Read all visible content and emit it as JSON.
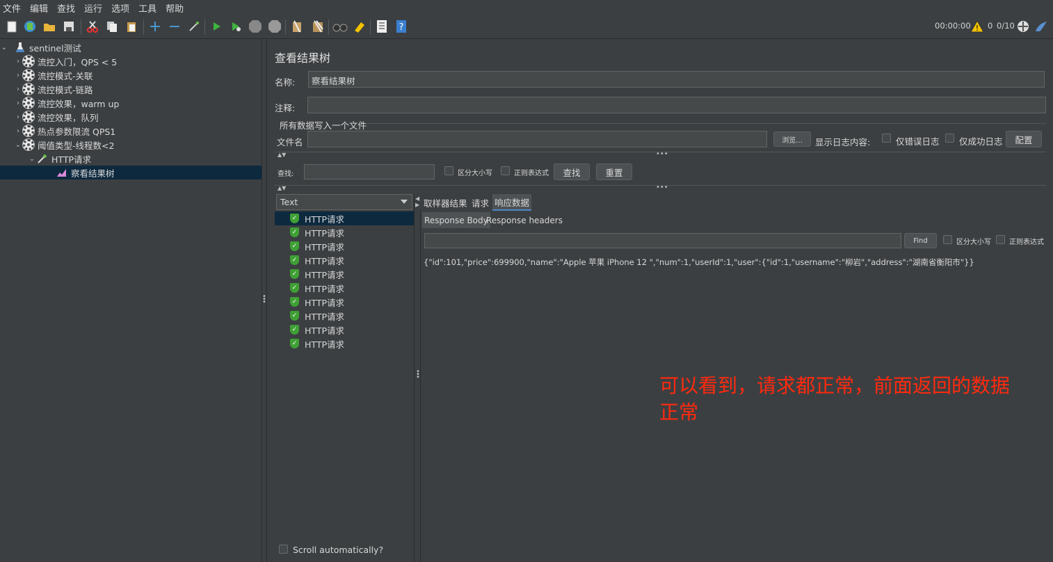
{
  "menu": [
    "文件",
    "编辑",
    "查找",
    "运行",
    "选项",
    "工具",
    "帮助"
  ],
  "status": {
    "timer": "00:00:00",
    "warnings": "0",
    "threads": "0/10"
  },
  "tree": {
    "root": "sentinel测试",
    "items": [
      "流控入门，QPS < 5",
      "流控模式-关联",
      "流控模式-链路",
      "流控效果，warm up",
      "流控效果，队列",
      "热点参数限流 QPS1",
      "阈值类型-线程数<2"
    ],
    "child": "HTTP请求",
    "grandchild": "察看结果树"
  },
  "panel": {
    "title": "查看结果树",
    "name_label": "名称:",
    "name_value": "察看结果树",
    "comment_label": "注释:",
    "comment_value": "",
    "write_all_label": "所有数据写入一个文件",
    "filename_label": "文件名",
    "filename_value": "",
    "browse_label": "浏览...",
    "log_content_label": "显示日志内容:",
    "errors_only_label": "仅错误日志",
    "success_only_label": "仅成功日志",
    "config_label": "配置"
  },
  "search": {
    "label": "查找:",
    "value": "",
    "case_label": "区分大小写",
    "regex_label": "正则表达式",
    "find_label": "查找",
    "reset_label": "重置"
  },
  "renderer": {
    "selected": "Text"
  },
  "samples": [
    "HTTP请求",
    "HTTP请求",
    "HTTP请求",
    "HTTP请求",
    "HTTP请求",
    "HTTP请求",
    "HTTP请求",
    "HTTP请求",
    "HTTP请求",
    "HTTP请求"
  ],
  "tabs": [
    "取样器结果",
    "请求",
    "响应数据"
  ],
  "active_tab": "响应数据",
  "subtabs": [
    "Response Body",
    "Response headers"
  ],
  "response_find": {
    "value": "",
    "find_label": "Find",
    "case_label": "区分大小写",
    "regex_label": "正则表达式"
  },
  "response_body": "{\"id\":101,\"price\":699900,\"name\":\"Apple 苹果 iPhone 12 \",\"num\":1,\"userId\":1,\"user\":{\"id\":1,\"username\":\"柳岩\",\"address\":\"湖南省衡阳市\"}}",
  "scroll_auto_label": "Scroll automatically?",
  "annotation": "可以看到，请求都正常，前面返回的数据正常",
  "colors": {
    "background": "#3c3f41",
    "selection": "#0d293e",
    "annotation": "#ff2a0f",
    "accent": "#4a88c7"
  }
}
